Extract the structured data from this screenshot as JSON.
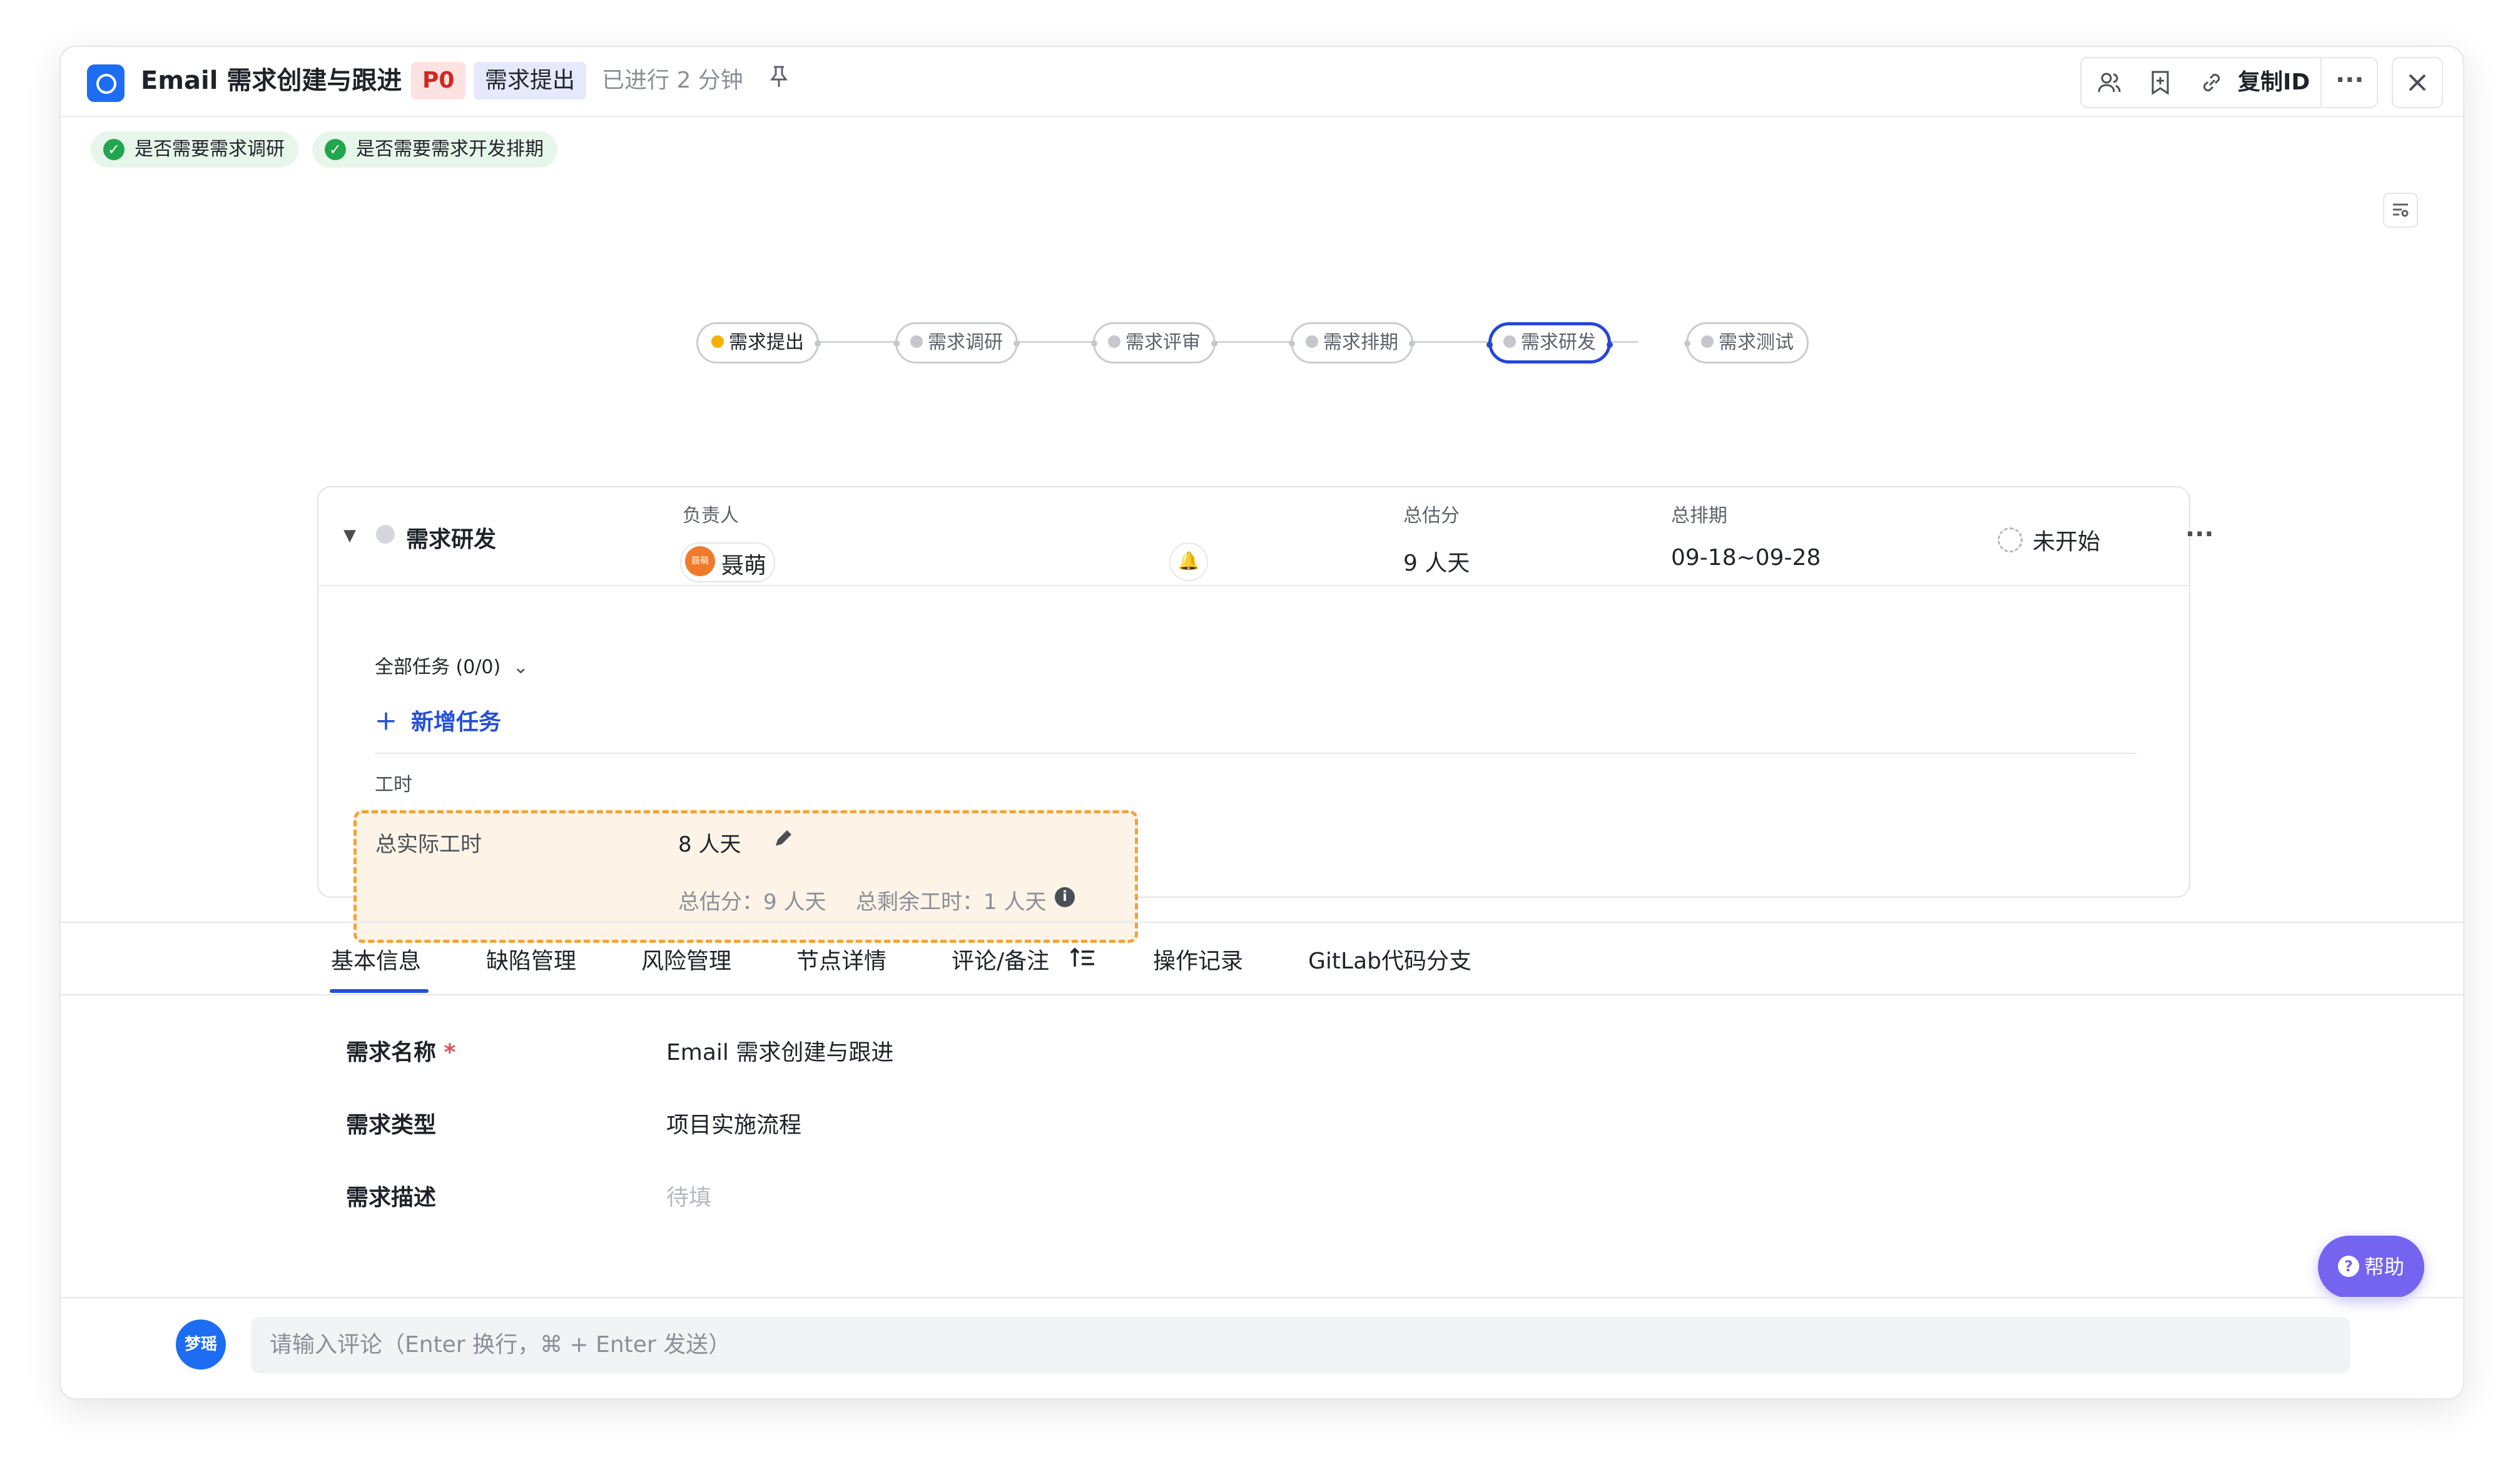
{
  "header": {
    "title": "Email 需求创建与跟进",
    "priority": "P0",
    "stage": "需求提出",
    "elapsed": "已进行 2 分钟",
    "copy_id": "复制ID"
  },
  "conditions": [
    {
      "label": "是否需要需求调研"
    },
    {
      "label": "是否需要需求开发排期"
    }
  ],
  "flow": {
    "nodes": [
      {
        "label": "需求提出",
        "state": "current"
      },
      {
        "label": "需求调研",
        "state": "pending"
      },
      {
        "label": "需求评审",
        "state": "pending"
      },
      {
        "label": "需求排期",
        "state": "pending"
      },
      {
        "label": "需求研发",
        "state": "selected"
      },
      {
        "label": "需求测试",
        "state": "pending"
      }
    ]
  },
  "node_card": {
    "name": "需求研发",
    "owner_label": "负责人",
    "owner_name": "聂萌",
    "owner_avatar": "聂萌",
    "estimate_label": "总估分",
    "estimate_value": "9 人天",
    "schedule_label": "总排期",
    "schedule_value": "09-18~09-28",
    "status": "未开始",
    "tasks_toggle": "全部任务 (0/0)",
    "add_task": "新增任务",
    "worklog_section": "工时",
    "actual_label": "总实际工时",
    "actual_value": "8 人天",
    "estimate_summary": "总估分：9 人天",
    "remaining_summary": "总剩余工时：1 人天"
  },
  "tabs": [
    {
      "label": "基本信息",
      "active": true
    },
    {
      "label": "缺陷管理"
    },
    {
      "label": "风险管理"
    },
    {
      "label": "节点详情"
    },
    {
      "label": "评论/备注"
    },
    {
      "label": "操作记录"
    },
    {
      "label": "GitLab代码分支"
    }
  ],
  "fields": [
    {
      "label": "需求名称",
      "required": true,
      "value": "Email 需求创建与跟进"
    },
    {
      "label": "需求类型",
      "value": "项目实施流程"
    },
    {
      "label": "需求描述",
      "value": "",
      "placeholder": "待填"
    }
  ],
  "comment": {
    "avatar": "梦瑶",
    "placeholder": "请输入评论（Enter 换行，⌘ + Enter 发送）"
  },
  "help": {
    "label": "帮助"
  },
  "colors": {
    "accent": "#2450d8",
    "priority_bg": "#fde2e2",
    "priority_text": "#d0281d",
    "success": "#21a54d",
    "worklog_border": "#f0a43c",
    "help_bg": "#7464f0"
  }
}
